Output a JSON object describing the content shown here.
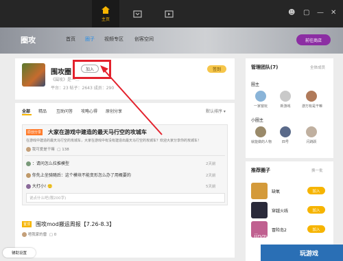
{
  "titlebar": {
    "tabs": [
      {
        "label": "主页",
        "icon": "home-icon",
        "active": true
      },
      {
        "label": "",
        "icon": "inbox-icon",
        "active": false
      },
      {
        "label": "",
        "icon": "video-icon",
        "active": false
      }
    ],
    "accent": "#f6b400"
  },
  "hero": {
    "title": "圈攻",
    "nav": [
      "首页",
      "圈子",
      "视频专区",
      "创客空间"
    ],
    "store_button": "前往商店"
  },
  "circle": {
    "name": "围攻圈",
    "join_label": "加入",
    "desc": "《围攻》是一...",
    "stats": "平台：23    帖子：2643    成员：290",
    "sign_label": "签到"
  },
  "feed": {
    "tabs": [
      "全部",
      "精品",
      "互助问答",
      "攻略心得",
      "原创分享"
    ],
    "sort_label": "默认排序",
    "post": {
      "tag": "原创分享",
      "title": "大家在游戏中建造的最天马行空的攻城车",
      "body": "在游戏中建造的最天马行空的攻城车，大家在游戏中有没有建造出最天马行空的攻城车？欢迎大家分享你的攻城车！",
      "author": "我可爱是干嘛",
      "views": "138",
      "comments": [
        {
          "text": "：请问怎么拉推模型",
          "time": "2天前"
        },
        {
          "text": "你先上坐骑随后：这个模块不能变形怎么办了用概要的",
          "time": "2天前"
        },
        {
          "text": "大打小! 🙂",
          "time": "5天前"
        }
      ],
      "reply_placeholder": "说点什么吧(限200字)"
    },
    "post2": {
      "tag": "置顶",
      "title": "围攻mod搬运周报【7.26-8.3】",
      "author": "唔我家的雷",
      "count": "0"
    }
  },
  "sidebar": {
    "team_title": "管理团队(7)",
    "team_link": "全体成员",
    "owner_label": "圈主",
    "owners": [
      {
        "name": "一家窗玩",
        "color": "#8ab4d8"
      },
      {
        "name": "新游戏",
        "color": "#c9c9c9"
      },
      {
        "name": "游万有是干嘛",
        "color": "#b07a5a"
      }
    ],
    "admin_label": "小圈主",
    "admins": [
      {
        "name": "就能做的人物",
        "color": "#9a8a6a"
      },
      {
        "name": "四号",
        "color": "#5a6a8a"
      },
      {
        "name": "闪跳跃",
        "color": "#c0b0a0"
      }
    ],
    "rec_title": "推荐圈子",
    "rec_link": "换一批",
    "rec": [
      {
        "name": "缺氧",
        "join": "加入",
        "color": "#d49a3a"
      },
      {
        "name": "穿越火线",
        "join": "加入",
        "color": "#2a2a3a"
      },
      {
        "name": "冒险岛2",
        "join": "加入",
        "color": "#c06090"
      }
    ]
  },
  "bottom": {
    "assist_label": "辅助设置",
    "play_label": "玩游戏",
    "watermark": "jingyan.baidu.com"
  }
}
